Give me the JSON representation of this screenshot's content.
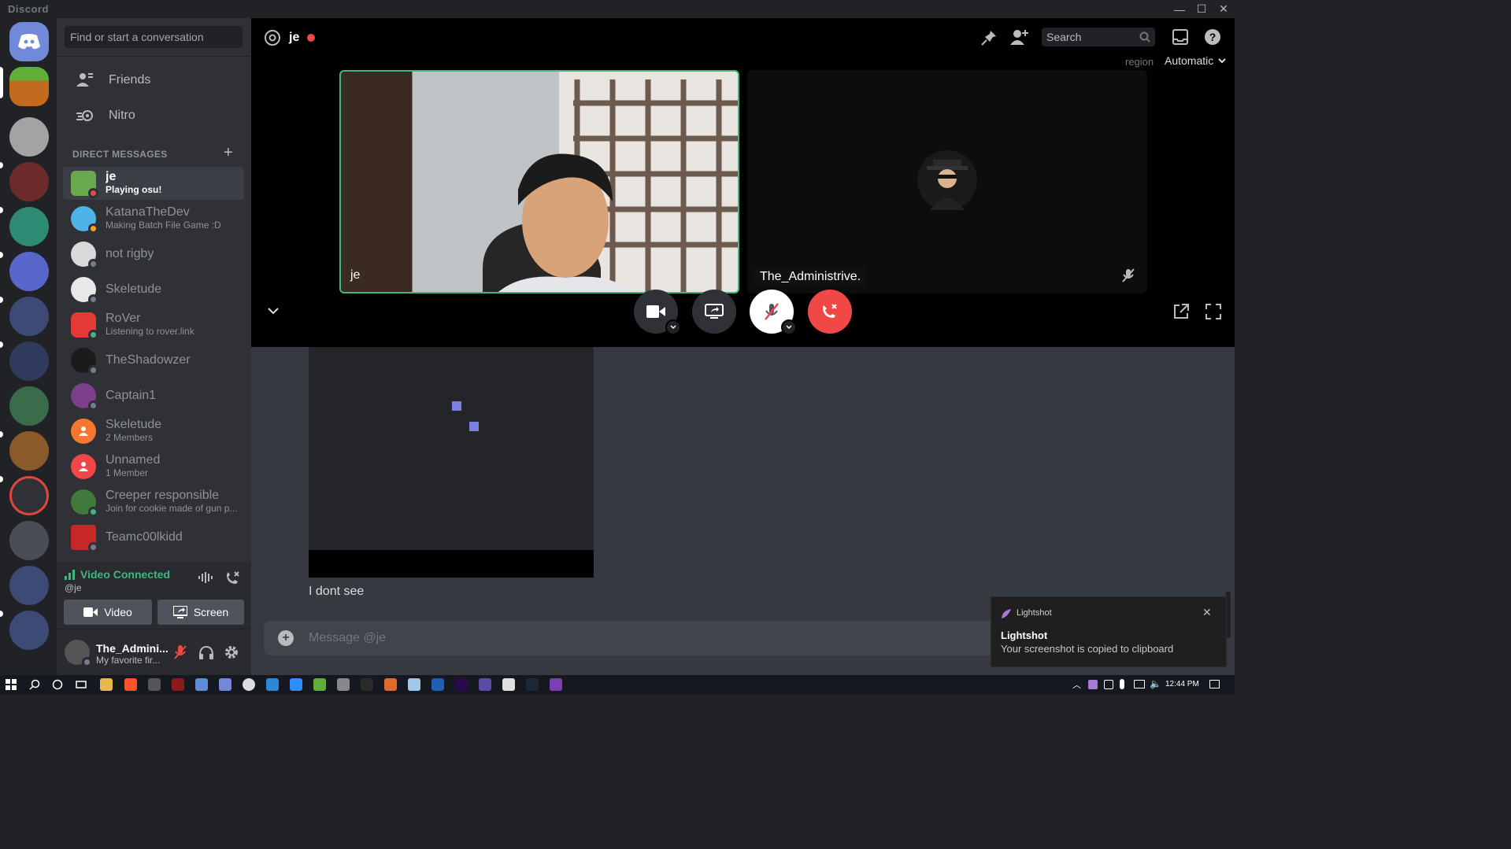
{
  "window": {
    "title": "Discord"
  },
  "sidebar": {
    "search_placeholder": "Find or start a conversation",
    "nav": [
      {
        "label": "Friends"
      },
      {
        "label": "Nitro"
      }
    ],
    "dm_header": "DIRECT MESSAGES",
    "dms": [
      {
        "name": "je",
        "sub": "Playing osu!",
        "status": "dnd"
      },
      {
        "name": "KatanaTheDev",
        "sub": "Making Batch File Game :D",
        "status": "idle"
      },
      {
        "name": "not rigby",
        "sub": "",
        "status": "offline"
      },
      {
        "name": "Skeletude",
        "sub": "",
        "status": "offline"
      },
      {
        "name": "RoVer",
        "sub": "Listening to rover.link",
        "status": "online"
      },
      {
        "name": "TheShadowzer",
        "sub": "",
        "status": "offline"
      },
      {
        "name": "Captain1",
        "sub": "",
        "status": "offline"
      },
      {
        "name": "Skeletude",
        "sub": "2 Members",
        "status": "group"
      },
      {
        "name": "Unnamed",
        "sub": "1 Member",
        "status": "group"
      },
      {
        "name": "Creeper responsible",
        "sub": "Join for cookie made of gun p...",
        "status": "online"
      },
      {
        "name": "Teamc00lkidd",
        "sub": "",
        "status": "offline"
      }
    ],
    "voice": {
      "title": "Video Connected",
      "sub": "@je",
      "video_label": "Video",
      "screen_label": "Screen"
    },
    "user": {
      "name": "The_Admini...",
      "status": "My favorite fir..."
    }
  },
  "call": {
    "channel_name": "je",
    "search_placeholder": "Search",
    "region_label": "region",
    "region_value": "Automatic",
    "tiles": [
      {
        "label": "je"
      },
      {
        "label": "The_Administrive."
      }
    ]
  },
  "chat": {
    "message": "I dont see",
    "input_placeholder": "Message @je"
  },
  "toast": {
    "app": "Lightshot",
    "title": "Lightshot",
    "body": "Your screenshot is copied to clipboard"
  },
  "taskbar": {
    "time": "12:44 PM"
  },
  "colors": {
    "accent": "#7289da",
    "online": "#43b581",
    "dnd": "#f04747",
    "idle": "#faa61a",
    "hangup": "#f04747"
  }
}
